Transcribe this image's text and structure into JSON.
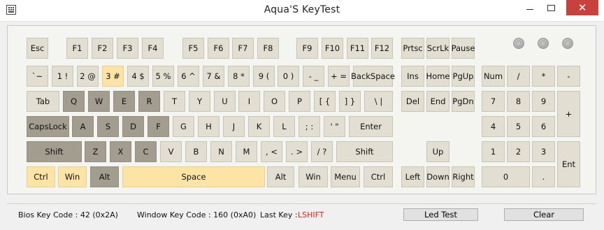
{
  "window": {
    "title": "Aqua'S KeyTest",
    "close_glyph": "✕"
  },
  "colors": {
    "pressed": "#a39d90",
    "highlighted": "#fce4a6",
    "normal": "#e2dfd2",
    "last_key": "#e0201c",
    "close": "#c7413d"
  },
  "keys": {
    "esc": "Esc",
    "f1": "F1",
    "f2": "F2",
    "f3": "F3",
    "f4": "F4",
    "f5": "F5",
    "f6": "F6",
    "f7": "F7",
    "f8": "F8",
    "f9": "F9",
    "f10": "F10",
    "f11": "F11",
    "f12": "F12",
    "prtsc": "Prtsc",
    "scrlk": "ScrLk",
    "pause": "Pause",
    "tilde": "`~",
    "n1": "1 !",
    "n2": "2 @",
    "n3": "3 #",
    "n4": "4 $",
    "n5": "5 %",
    "n6": "6 ^",
    "n7": "7 &",
    "n8": "8 *",
    "n9": "9 (",
    "n0": "0 )",
    "minus": "- _",
    "equals": "+ =",
    "backspace": "BackSpace",
    "tab": "Tab",
    "q": "Q",
    "w": "W",
    "e": "E",
    "r": "R",
    "t": "T",
    "y": "Y",
    "u": "U",
    "i": "I",
    "o": "O",
    "p": "P",
    "lbracket": "[ {",
    "rbracket": "] }",
    "backslash": "\\ |",
    "capslock": "CapsLock",
    "a": "A",
    "s": "S",
    "d": "D",
    "f": "F",
    "g": "G",
    "h": "H",
    "j": "J",
    "k": "K",
    "l": "L",
    "semicolon": "; :",
    "quote": "' \"",
    "enter": "Enter",
    "lshift": "Shift",
    "z": "Z",
    "x": "X",
    "c": "C",
    "v": "V",
    "b": "B",
    "n": "N",
    "m": "M",
    "comma": ", <",
    "period": ". >",
    "slash": "/ ?",
    "rshift": "Shift",
    "lctrl": "Ctrl",
    "lwin": "Win",
    "lalt": "Alt",
    "space": "Space",
    "ralt": "Alt",
    "rwin": "Win",
    "menu": "Menu",
    "rctrl": "Ctrl",
    "ins": "Ins",
    "home": "Home",
    "pgup": "PgUp",
    "del": "Del",
    "end": "End",
    "pgdn": "PgDn",
    "up": "Up",
    "left": "Left",
    "down": "Down",
    "right": "Right",
    "numlock": "Num",
    "kp_div": "/",
    "kp_mul": "*",
    "kp_sub": "-",
    "kp7": "7",
    "kp8": "8",
    "kp9": "9",
    "kp_add": "+",
    "kp4": "4",
    "kp5": "5",
    "kp6": "6",
    "kp1": "1",
    "kp2": "2",
    "kp3": "3",
    "kp_enter": "Ent",
    "kp0": "0",
    "kp_dot": "."
  },
  "key_states": {
    "pressed": [
      "q",
      "w",
      "e",
      "r",
      "capslock",
      "a",
      "s",
      "d",
      "f",
      "lshift",
      "z",
      "x",
      "c",
      "lalt"
    ],
    "highlighted": [
      "n3",
      "lctrl",
      "lwin",
      "space"
    ]
  },
  "leds": [
    "num-lock-led",
    "caps-lock-led",
    "scroll-lock-led"
  ],
  "status": {
    "bios_key_code": "Bios Key Code : 42 (0x2A)",
    "window_key_code": "Window Key Code : 160 (0xA0)",
    "last_key_label": "Last Key :",
    "last_key_value": "LSHIFT",
    "led_test_button": "Led Test",
    "clear_button": "Clear"
  }
}
